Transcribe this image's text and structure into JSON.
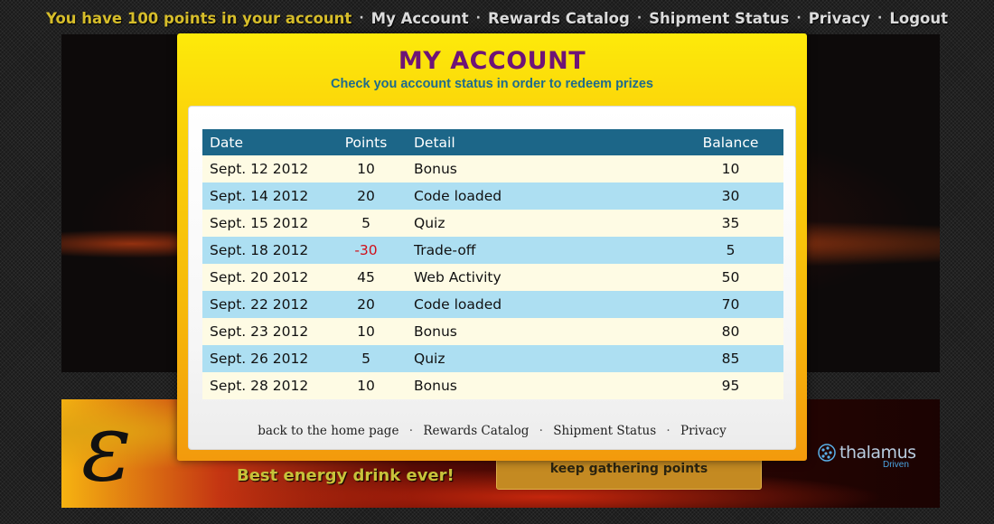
{
  "topnav": {
    "points_message": "You have 100 points in your account",
    "separator": "·",
    "links": [
      "My Account",
      "Rewards Catalog",
      "Shipment Status",
      "Privacy",
      "Logout"
    ]
  },
  "modal": {
    "title": "MY ACCOUNT",
    "subtitle": "Check you account status in order to redeem prizes",
    "table": {
      "headers": [
        "Date",
        "Points",
        "Detail",
        "Balance"
      ],
      "rows": [
        {
          "date": "Sept. 12 2012",
          "points": "10",
          "detail": "Bonus",
          "balance": "10"
        },
        {
          "date": "Sept. 14 2012",
          "points": "20",
          "detail": "Code loaded",
          "balance": "30"
        },
        {
          "date": "Sept. 15 2012",
          "points": "5",
          "detail": "Quiz",
          "balance": "35"
        },
        {
          "date": "Sept. 18 2012",
          "points": "-30",
          "detail": "Trade-off",
          "balance": "5"
        },
        {
          "date": "Sept. 20 2012",
          "points": "45",
          "detail": "Web Activity",
          "balance": "50"
        },
        {
          "date": "Sept. 22 2012",
          "points": "20",
          "detail": "Code loaded",
          "balance": "70"
        },
        {
          "date": "Sept. 23 2012",
          "points": "10",
          "detail": "Bonus",
          "balance": "80"
        },
        {
          "date": "Sept. 26 2012",
          "points": "5",
          "detail": "Quiz",
          "balance": "85"
        },
        {
          "date": "Sept. 28 2012",
          "points": "10",
          "detail": "Bonus",
          "balance": "95"
        }
      ]
    },
    "footer_links": [
      "back to the home page",
      "Rewards Catalog",
      "Shipment Status",
      "Privacy"
    ],
    "footer_separator": "·"
  },
  "banner": {
    "tagline": "Best energy drink ever!",
    "button_label": "keep gathering points",
    "brand_name": "thalamus",
    "brand_sub": "Driven"
  },
  "colors": {
    "accent_title": "#6e1477",
    "subtitle": "#1f6b8c",
    "table_header": "#1c6688",
    "row_odd": "#fefbe4",
    "row_even": "#addff2",
    "negative": "#d0101a",
    "modal_gradient_top": "#fdea0a",
    "modal_gradient_bottom": "#f39a0c"
  }
}
